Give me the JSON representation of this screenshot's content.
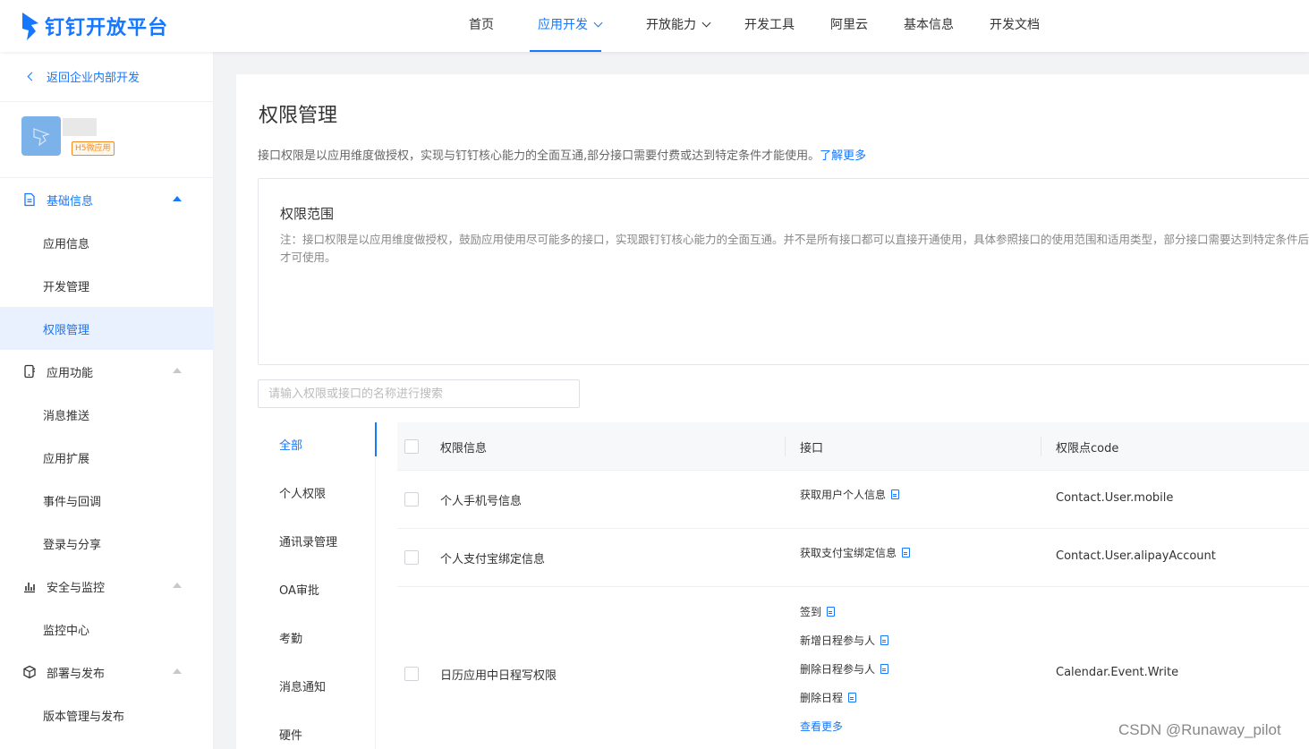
{
  "nav": {
    "logo_text": "钉钉开放平台",
    "items": [
      {
        "label": "首页"
      },
      {
        "label": "应用开发"
      },
      {
        "label": "开放能力"
      },
      {
        "label": "开发工具"
      },
      {
        "label": "阿里云"
      },
      {
        "label": "基本信息"
      },
      {
        "label": "开发文档"
      }
    ]
  },
  "sidebar": {
    "back_label": "返回企业内部开发",
    "app_badge": "H5微应用",
    "groups": [
      {
        "label": "基础信息",
        "icon": "document-icon",
        "items": [
          {
            "label": "应用信息"
          },
          {
            "label": "开发管理"
          },
          {
            "label": "权限管理"
          }
        ]
      },
      {
        "label": "应用功能",
        "icon": "phone-icon",
        "items": [
          {
            "label": "消息推送"
          },
          {
            "label": "应用扩展"
          },
          {
            "label": "事件与回调"
          },
          {
            "label": "登录与分享"
          }
        ]
      },
      {
        "label": "安全与监控",
        "icon": "bar-chart-icon",
        "items": [
          {
            "label": "监控中心"
          }
        ]
      },
      {
        "label": "部署与发布",
        "icon": "cube-icon",
        "items": [
          {
            "label": "版本管理与发布"
          }
        ]
      }
    ]
  },
  "main": {
    "title": "权限管理",
    "desc": "接口权限是以应用维度做授权，实现与钉钉核心能力的全面互通,部分接口需要付费或达到特定条件才能使用。",
    "learn_more": "了解更多",
    "scope_title": "权限范围",
    "scope_note": "注：接口权限是以应用维度做授权，鼓励应用使用尽可能多的接口，实现跟钉钉核心能力的全面互通。并不是所有接口都可以直接开通使用，具体参照接口的使用范围和适用类型，部分接口需要达到特定条件后才可使用。",
    "search_placeholder": "请输入权限或接口的名称进行搜索",
    "categories": [
      {
        "label": "全部"
      },
      {
        "label": "个人权限"
      },
      {
        "label": "通讯录管理"
      },
      {
        "label": "OA审批"
      },
      {
        "label": "考勤"
      },
      {
        "label": "消息通知"
      },
      {
        "label": "硬件"
      }
    ],
    "table": {
      "headers": {
        "info": "权限信息",
        "api": "接口",
        "code": "权限点code"
      },
      "rows": [
        {
          "name": "个人手机号信息",
          "apis": [
            "获取用户个人信息"
          ],
          "code": "Contact.User.mobile"
        },
        {
          "name": "个人支付宝绑定信息",
          "apis": [
            "获取支付宝绑定信息"
          ],
          "code": "Contact.User.alipayAccount"
        },
        {
          "name": "日历应用中日程写权限",
          "apis": [
            "签到",
            "新增日程参与人",
            "删除日程参与人",
            "删除日程"
          ],
          "more": "查看更多",
          "code": "Calendar.Event.Write"
        }
      ]
    }
  },
  "watermark": "CSDN @Runaway_pilot",
  "colors": {
    "accent": "#1677ff",
    "badge": "#f58a1f"
  }
}
